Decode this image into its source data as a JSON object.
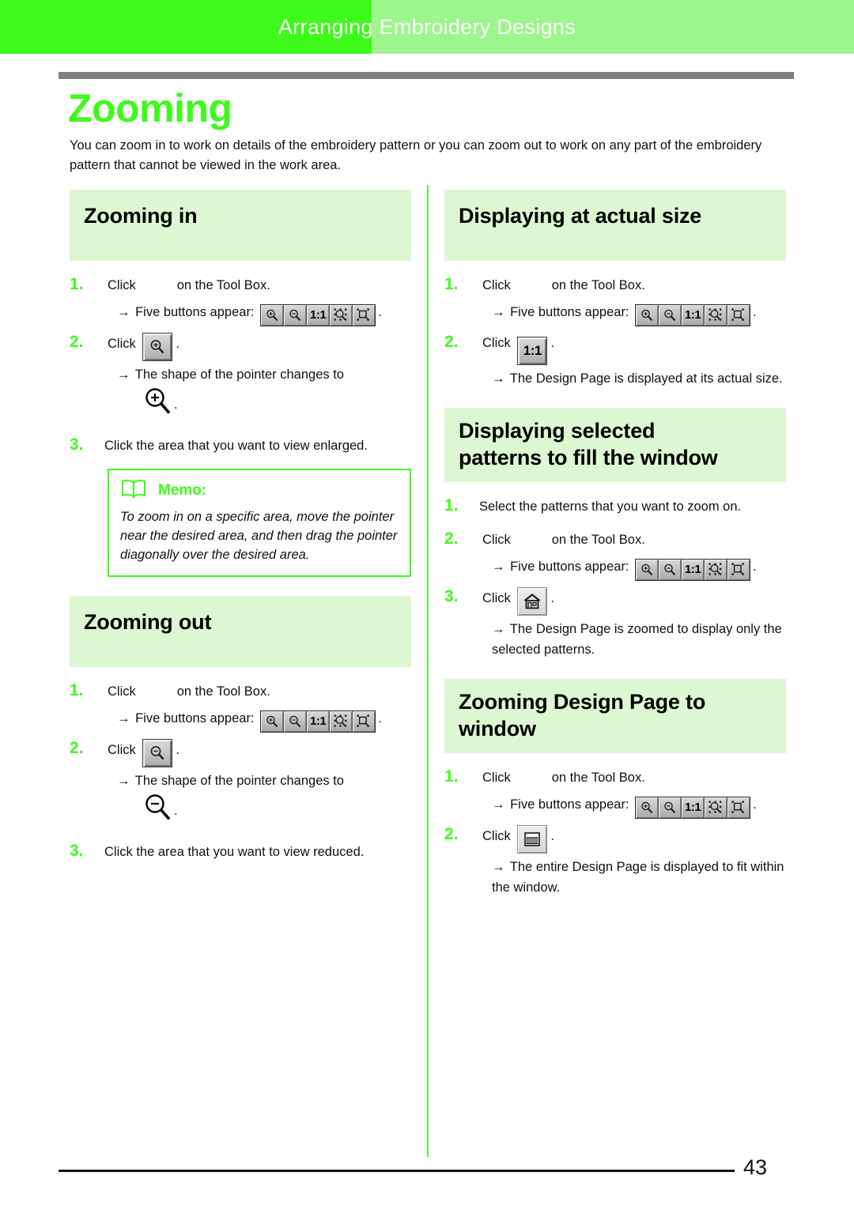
{
  "header": {
    "chapter_title": "Arranging Embroidery Designs",
    "banner_color": "#3dfa1b",
    "banner_tint_color": "#9df58d"
  },
  "page": {
    "title": "Zooming",
    "title_color": "#3dfa1b",
    "intro": "You can zoom in to work on details of the embroidery pattern or you can zoom out to work on any part of the embroidery pattern that cannot be viewed in the work area.",
    "number": "43"
  },
  "common": {
    "click": "Click",
    "on_the_tool_box": "on the Tool Box.",
    "five_buttons_appear": "Five buttons appear:",
    "period": ".",
    "arrow": "→",
    "ratio_label": "1:1"
  },
  "toolbar": {
    "buttons": [
      {
        "name": "zoom-in-icon",
        "label": ""
      },
      {
        "name": "zoom-out-icon",
        "label": ""
      },
      {
        "name": "actual-size-icon",
        "label": "1:1"
      },
      {
        "name": "zoom-to-selection-icon",
        "label": ""
      },
      {
        "name": "zoom-to-page-icon",
        "label": ""
      }
    ]
  },
  "left_column": {
    "sections": [
      {
        "id": "zooming-in",
        "title": "Zooming in",
        "steps": [
          {
            "num": "1.",
            "text_before": "Click",
            "text_after": "on the Tool Box.",
            "result": "Five buttons appear:"
          },
          {
            "num": "2.",
            "text_before": "Click",
            "result": "The shape of the pointer changes to"
          },
          {
            "num": "3.",
            "text": "Click the area that you want to view enlarged."
          }
        ],
        "memo": {
          "label": "Memo:",
          "text": "To zoom in on a specific area, move the pointer near the desired area, and then drag the pointer diagonally over the desired area."
        }
      },
      {
        "id": "zooming-out",
        "title": "Zooming out",
        "steps": [
          {
            "num": "1.",
            "text_before": "Click",
            "text_after": "on the Tool Box.",
            "result": "Five buttons appear:"
          },
          {
            "num": "2.",
            "text_before": "Click",
            "result": "The shape of the pointer changes to"
          },
          {
            "num": "3.",
            "text": "Click the area that you want to view reduced."
          }
        ]
      }
    ]
  },
  "right_column": {
    "sections": [
      {
        "id": "displaying-at-actual-size",
        "title": "Displaying at actual size",
        "steps": [
          {
            "num": "1.",
            "text_before": "Click",
            "text_after": "on the Tool Box.",
            "result": "Five buttons appear:"
          },
          {
            "num": "2.",
            "text_before": "Click",
            "button_label": "1:1",
            "result": "The Design Page is displayed at its actual size."
          }
        ]
      },
      {
        "id": "displaying-selected-patterns",
        "title_line1": "Displaying selected",
        "title_line2": "patterns to fill the window",
        "steps": [
          {
            "num": "1.",
            "text": "Select the patterns that you want to zoom on."
          },
          {
            "num": "2.",
            "text_before": "Click",
            "text_after": "on the Tool Box.",
            "result": "Five buttons appear:"
          },
          {
            "num": "3.",
            "text_before": "Click",
            "result": "The Design Page is zoomed to display only the selected patterns."
          }
        ]
      },
      {
        "id": "zooming-design-page-to-window",
        "title_line1": "Zooming Design Page to",
        "title_line2": "window",
        "steps": [
          {
            "num": "1.",
            "text_before": "Click",
            "text_after": "on the Tool Box.",
            "result": "Five buttons appear:"
          },
          {
            "num": "2.",
            "text_before": "Click",
            "result": "The entire Design Page is displayed to fit within the window."
          }
        ]
      }
    ]
  }
}
